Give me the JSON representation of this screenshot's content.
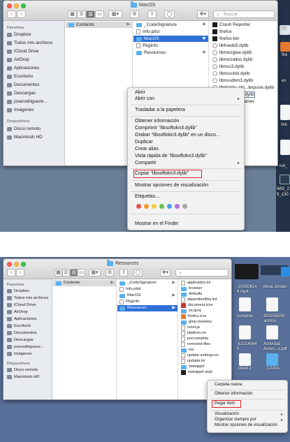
{
  "top": {
    "title": "MacOS",
    "search_placeholder": "Buscar",
    "sidebar": {
      "favorites_heading": "Favoritos",
      "favorites": [
        "Dropbox",
        "Todos mis archivos",
        "iCloud Drive",
        "AirDrop",
        "Aplicaciones",
        "Escritorio",
        "Documentos",
        "Descargas",
        "joserodrigueze...",
        "Imágenes"
      ],
      "devices_heading": "Dispositivos",
      "devices": [
        "Disco remoto",
        "Macintosh HD"
      ]
    },
    "col1": [
      "Contents"
    ],
    "col2": [
      "_CodeSignature",
      "Info.plist",
      "MacOS",
      "PkgInfo",
      "Resources"
    ],
    "col3": [
      "Crash Reporter",
      "firefox",
      "firefox-bin",
      "libfreebl3.dylib",
      "libmozglue.dylib",
      "libmozalloc.dylib",
      "libnss3.dylib",
      "libnssckbi.dylib",
      "libnssdbm3.dylib",
      "libplugin_chi...terpose.dylib",
      "...dylib",
      "...ainer"
    ],
    "context_menu": {
      "group1": [
        "Abrir",
        "Abrir con"
      ],
      "group2": [
        "Trasladar a la papelera"
      ],
      "group3": [
        "Obtener información",
        "Comprimir “libsoftokn3.dylib”",
        "Grabar “libsoftokn3.dylib” en un disco...",
        "Duplicar",
        "Crear alias",
        "Vista rápida de “libsoftokn3.dylib”",
        "Compartir"
      ],
      "copy_item": "Copiar “libsoftokn3.dylib”",
      "view_options": "Mostrar opciones de visualización",
      "tags_label": "Etiquetas...",
      "tag_colors": [
        "#e8524a",
        "#f39a37",
        "#f6cd3c",
        "#67c24c",
        "#4a9ef0",
        "#b46fd6",
        "#a7a7a7"
      ],
      "finder_item": "Mostrar en el Finder",
      "submenu_arrow": "▸"
    },
    "desktop_labels": [
      "-20",
      "fire",
      "es",
      "tick",
      "IMG_2",
      "9_130",
      "lud_"
    ]
  },
  "bottom": {
    "title": "Resources",
    "sidebar": {
      "favorites_heading": "Favoritos",
      "favorites": [
        "Dropbox",
        "Todos mis archivos",
        "iCloud Drive",
        "AirDrop",
        "Aplicaciones",
        "Escritorio",
        "Documentos",
        "Descargas",
        "joserodrigueze...",
        "Imágenes"
      ],
      "devices_heading": "Dispositivos",
      "devices": [
        "Disco remoto",
        "Macintosh HD"
      ]
    },
    "col1": [
      "Contents"
    ],
    "col2": [
      "_CodeSignature",
      "Info.plist",
      "MacOS",
      "PkgInfo",
      "Resources"
    ],
    "col3": [
      "application.ini",
      "browser",
      "defaults",
      "dependentlibs.list",
      "document.icns",
      "es.lproj",
      "firefox.icns",
      "gmp-clearkey",
      "omni.ja",
      "platform.ini",
      "precomplete",
      "removed-files",
      "res",
      "update-settings.ini",
      "updater.ini",
      "webapprt",
      "webapprt-stub"
    ],
    "context_menu": {
      "items_top": [
        "Carpeta nueva"
      ],
      "items_mid": [
        "Obtener información"
      ],
      "paste_item": "Pegar ítem",
      "items_bottom": [
        "Visualización",
        "Organizar siempre por",
        "Mostrar opciones de visualización"
      ],
      "submenu_arrow": "▸"
    },
    "desktop_labels": [
      "-20150614",
      "4.mp4",
      "Alicia Jordan",
      "compras",
      "902555530",
      "anston",
      "-62214064",
      "5",
      "Actividad",
      "Anton...s.pdf",
      "ticket 2",
      "CAIXA"
    ]
  },
  "colors": {
    "accent": "#2f6fd6",
    "highlight_box": "#e0242a",
    "folder": "#5ab0ee"
  }
}
